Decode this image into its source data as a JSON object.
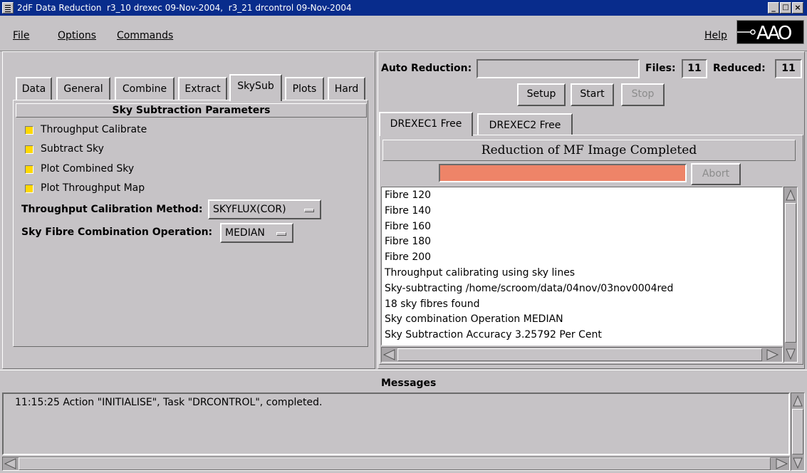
{
  "window": {
    "title": "2dF Data Reduction  r3_10 drexec 09-Nov-2004,  r3_21 drcontrol 09-Nov-2004",
    "controls": [
      "_",
      "□",
      "×"
    ]
  },
  "menubar": {
    "file": "File",
    "options": "Options",
    "commands": "Commands",
    "help": "Help",
    "logo": "AAO"
  },
  "left_panel": {
    "tabs": [
      "Data",
      "General",
      "Combine",
      "Extract",
      "SkySub",
      "Plots",
      "Hard"
    ],
    "active_tab": "SkySub",
    "section_title": "Sky Subtraction Parameters",
    "checkboxes": [
      {
        "label": "Throughput Calibrate",
        "checked": true
      },
      {
        "label": "Subtract Sky",
        "checked": true
      },
      {
        "label": "Plot Combined Sky",
        "checked": true
      },
      {
        "label": "Plot Throughput Map",
        "checked": true
      }
    ],
    "throughput_method_label": "Throughput Calibration Method:",
    "throughput_method_value": "SKYFLUX(COR)",
    "combination_label": "Sky Fibre Combination Operation:",
    "combination_value": "MEDIAN"
  },
  "auto_reduction": {
    "label": "Auto Reduction:",
    "value": "",
    "files_label": "Files:",
    "files_value": "11",
    "reduced_label": "Reduced:",
    "reduced_value": "11",
    "setup": "Setup",
    "start": "Start",
    "stop": "Stop"
  },
  "drexec": {
    "tabs": [
      "DREXEC1 Free",
      "DREXEC2 Free"
    ],
    "status": "Reduction of MF Image Completed",
    "progress_color": "#ee8468",
    "abort": "Abort",
    "log": [
      "Fibre 120",
      "Fibre 140",
      "Fibre 160",
      "Fibre 180",
      "Fibre 200",
      "Throughput calibrating using sky lines",
      "Sky-subtracting /home/scroom/data/04nov/03nov0004red",
      "18 sky fibres found",
      "Sky combination Operation MEDIAN",
      "Sky Subtraction Accuracy 3.25792 Per Cent"
    ]
  },
  "messages": {
    "title": "Messages",
    "lines": [
      "11:15:25 Action \"INITIALISE\", Task \"DRCONTROL\", completed."
    ]
  }
}
